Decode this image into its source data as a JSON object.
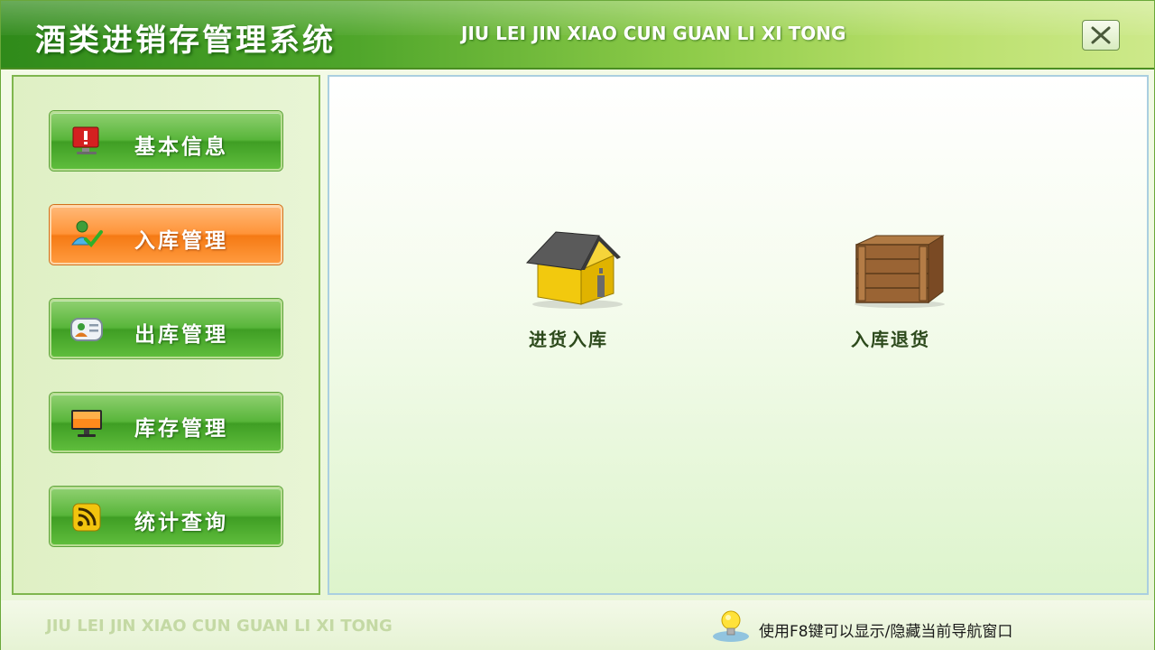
{
  "window": {
    "title": "酒类进销存管理系统",
    "subtitle": "JIU LEI JIN XIAO CUN GUAN LI XI TONG",
    "close_icon": "close-icon"
  },
  "colors": {
    "accent_green": "#4ea52a",
    "active_orange": "#ff9438",
    "content_text": "#2d4a1c"
  },
  "sidebar": {
    "items": [
      {
        "label": "基本信息",
        "icon": "monitor-alert-icon",
        "active": false
      },
      {
        "label": "入库管理",
        "icon": "user-check-icon",
        "active": true
      },
      {
        "label": "出库管理",
        "icon": "contact-card-icon",
        "active": false
      },
      {
        "label": "库存管理",
        "icon": "display-screen-icon",
        "active": false
      },
      {
        "label": "统计查询",
        "icon": "rss-feed-icon",
        "active": false
      }
    ]
  },
  "main": {
    "tiles": [
      {
        "label": "进货入库",
        "icon": "house-icon"
      },
      {
        "label": "入库退货",
        "icon": "wooden-crate-icon"
      }
    ]
  },
  "footer": {
    "brand": "JIU LEI JIN XIAO CUN GUAN LI XI TONG",
    "hint": "使用F8键可以显示/隐藏当前导航窗口",
    "hint_icon": "lightbulb-icon"
  }
}
